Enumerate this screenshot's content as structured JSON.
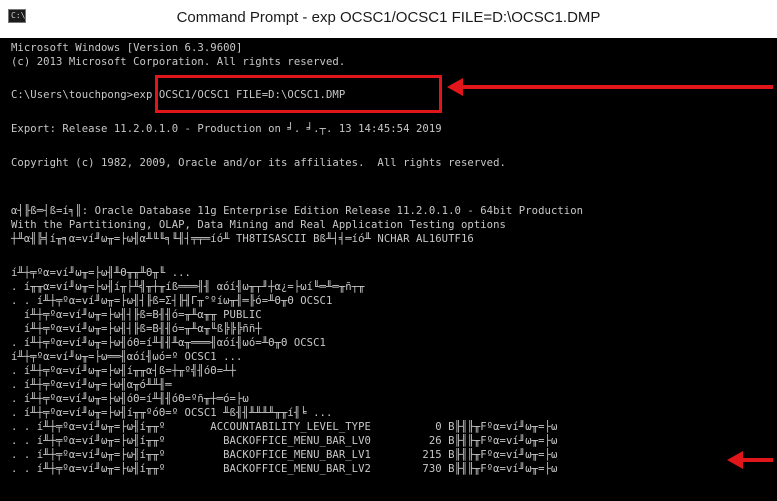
{
  "window": {
    "title": "Command Prompt - exp  OCSC1/OCSC1 FILE=D:\\OCSC1.DMP",
    "icon_label": "C:\\",
    "icon": "cmd-icon"
  },
  "console_lines": [
    "Microsoft Windows [Version 6.3.9600]",
    "(c) 2013 Microsoft Corporation. All rights reserved.",
    "",
    "C:\\Users\\touchpong>exp OCSC1/OCSC1 FILE=D:\\OCSC1.DMP",
    "",
    "Export: Release 11.2.0.1.0 - Production on ╛. ╛.┬. 13 14:45:54 2019",
    "",
    "Copyright (c) 1982, 2009, Oracle and/or its affiliates.  All rights reserved.",
    "",
    "",
    "α┤╟ß═┤ß=í╕║: Oracle Database 11g Enterprise Edition Release 11.2.0.1.0 - 64bit Production",
    "With the Partitioning, OLAP, Data Mining and Real Application Testing options",
    "┼╨α╢╠╡í╥╕α=ví╜ω╥=├ω╢α╨╙╙╕╙╢┤╤╤═íó╨ TH8TISASCII Bß╨┤╡═íó╨ NCHAR AL16UTF16",
    "",
    "í╨┼╤ºα=ví╜ω╥=├ω╢╨Θ╥╥╨Θ╥╙ ...",
    ". í╥╥α=ví╜ω╥=├ω╢í╥├╨╣╥┼╥íß═══╢╢ αóí╢ω╥┬╜┼α¿=├ωí╙═╨═╥ñ┬╥",
    ". . í╨┼╤ºα=ví╜ω╥=├ω╢┤╟ß=Σ┤╟╢Γ╥°ºíω╥╢═╟ó=╨Θ╥Θ OCSC1",
    "  í╨┼╤ºα=ví╜ω╥=├ω╢┤╟ß=B╢╢ó=╥╨α╥╥ PUBLIC",
    "  í╨┼╤ºα=ví╜ω╥=├ω╢┤╟ß=B╢╢ó=╥╨α╥╙ß╠╠╠ññ┼",
    ". í╨┼╤ºα=ví╜ω╥=├ω╢óΘ=í╨╢╢╨α╥═══╢αóí╢ωó=╨Θ╥Θ OCSC1",
    "í╨┼╤ºα=ví╜ω╥=├ω══╢αóí╢ωó=º OCSC1 ...",
    ". í╨┼╤ºα=ví╜ω╥=├ω╢í╥╥α┤ß=┼╥º╣╢óΘ=┴┼",
    ". í╨┼╤ºα=ví╜ω╥=├ω╢α╥ó╨╨╢═",
    ". í╨┼╤ºα=ví╜ω╥=├ω╢óΘ=í╨╢╢óΘ=ºñ╥┼═ó=├ω",
    ". í╨┼╤ºα=ví╜ω╥=├ω╢í╥╥ºóΘ=º OCSC1 ╨ß╢╢╨╨╨╨╥╥í╢╘ ...",
    ". . í╨┼╤ºα=ví╜ω╥=├ω╢í╥╥º       ACCOUNTABILITY_LEVEL_TYPE          0 B╟╢╟╥Fºα=ví╜ω╥=├ω",
    ". . í╨┼╤ºα=ví╜ω╥=├ω╢í╥╥º         BACKOFFICE_MENU_BAR_LV0         26 B╟╢╟╥Fºα=ví╜ω╥=├ω",
    ". . í╨┼╤ºα=ví╜ω╥=├ω╢í╥╥º         BACKOFFICE_MENU_BAR_LV1        215 B╟╢╟╥Fºα=ví╜ω╥=├ω",
    ". . í╨┼╤ºα=ví╜ω╥=├ω╢í╥╥º         BACKOFFICE_MENU_BAR_LV2        730 B╟╢╟╥Fºα=ví╜ω╥=├ω"
  ],
  "annotations": {
    "highlight_color": "#e0161b",
    "console_bg": "#000000",
    "console_fg": "#c8c8c8"
  }
}
